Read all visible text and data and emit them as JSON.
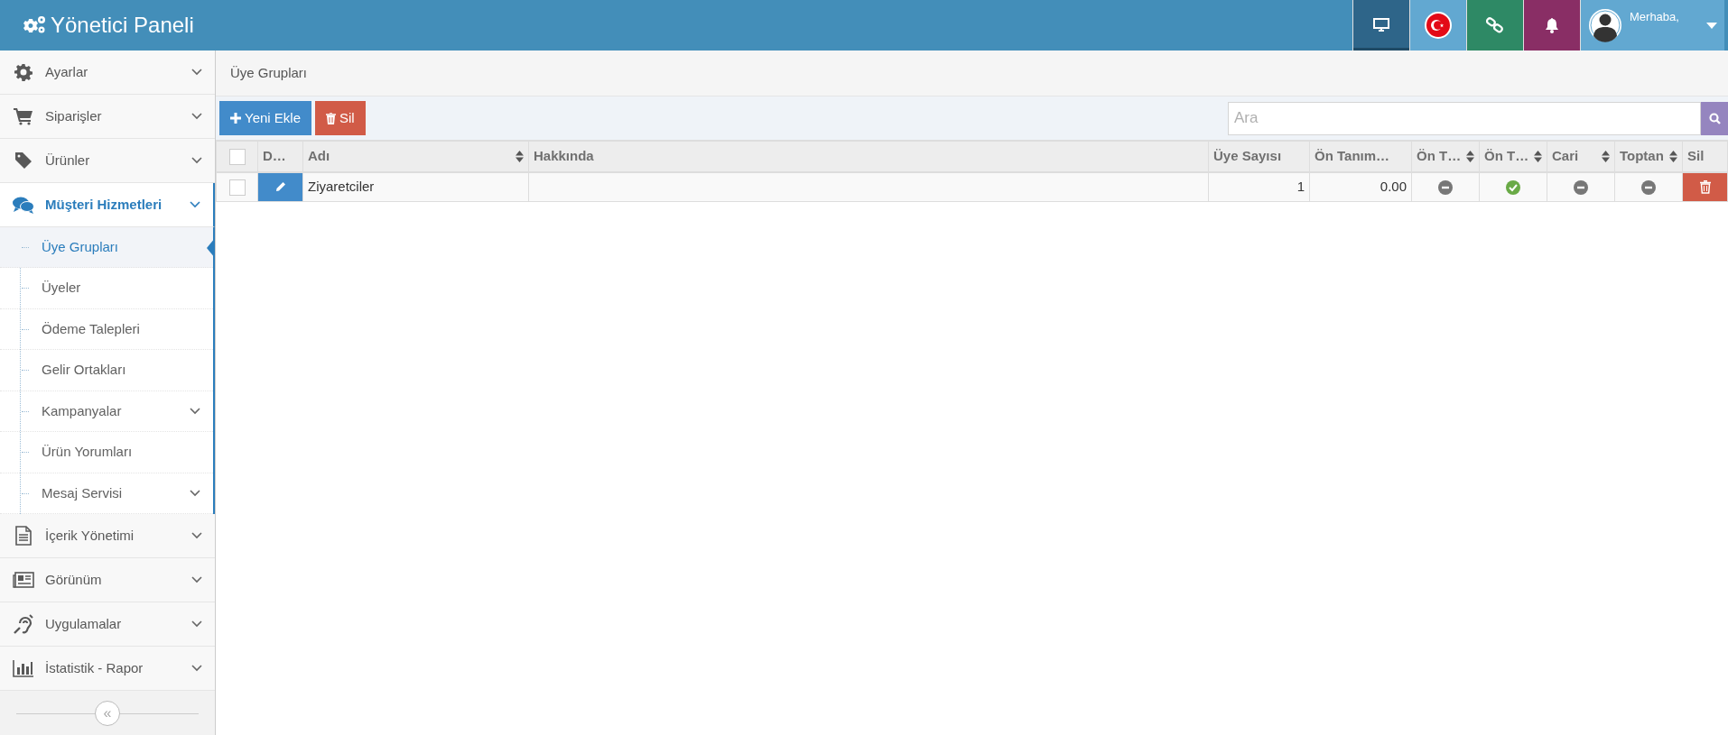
{
  "navbar": {
    "title": "Yönetici Paneli",
    "tiles": [
      {
        "kind": "monitor",
        "selected": true
      },
      {
        "kind": "flag",
        "selected": false
      },
      {
        "kind": "link",
        "selected": false
      },
      {
        "kind": "bell",
        "selected": false
      }
    ],
    "user": {
      "greeting": "Merhaba,"
    }
  },
  "sidebar": {
    "items": [
      {
        "label": "Ayarlar",
        "expanded": false,
        "selected": false
      },
      {
        "label": "Siparişler",
        "expanded": false,
        "selected": false
      },
      {
        "label": "Ürünler",
        "expanded": false,
        "selected": false
      },
      {
        "label": "Müşteri Hizmetleri",
        "expanded": true,
        "selected": true,
        "children": [
          {
            "label": "Üye Grupları",
            "selected": true,
            "submenu": false
          },
          {
            "label": "Üyeler",
            "selected": false,
            "submenu": false
          },
          {
            "label": "Ödeme Talepleri",
            "selected": false,
            "submenu": false
          },
          {
            "label": "Gelir Ortakları",
            "selected": false,
            "submenu": false
          },
          {
            "label": "Kampanyalar",
            "selected": false,
            "submenu": true
          },
          {
            "label": "Ürün Yorumları",
            "selected": false,
            "submenu": false
          },
          {
            "label": "Mesaj Servisi",
            "selected": false,
            "submenu": true
          }
        ]
      },
      {
        "label": "İçerik Yönetimi",
        "expanded": false,
        "selected": false
      },
      {
        "label": "Görünüm",
        "expanded": false,
        "selected": false
      },
      {
        "label": "Uygulamalar",
        "expanded": false,
        "selected": false
      },
      {
        "label": "İstatistik - Rapor",
        "expanded": false,
        "selected": false
      }
    ],
    "collapse_button": {
      "label": "«"
    }
  },
  "breadcrumb": "Üye Grupları",
  "toolbar": {
    "buttons": [
      {
        "kind": "add",
        "label": "Yeni Ekle"
      },
      {
        "kind": "delete",
        "label": "Sil"
      }
    ],
    "search": {
      "placeholder": "Ara"
    }
  },
  "table": {
    "columns": [
      {
        "kind": "checkbox",
        "checked": false
      },
      {
        "kind": "text",
        "label": "D…",
        "sortable": false
      },
      {
        "kind": "text",
        "label": "Adı",
        "sortable": true
      },
      {
        "kind": "text",
        "label": "Hakkında",
        "sortable": false
      },
      {
        "kind": "text",
        "label": "Üye Sayısı",
        "sortable": false
      },
      {
        "kind": "text",
        "label": "Ön Tanım…",
        "sortable": false
      },
      {
        "kind": "text",
        "label": "Ön T…",
        "sortable": true
      },
      {
        "kind": "text",
        "label": "Ön T…",
        "sortable": true
      },
      {
        "kind": "text",
        "label": "Cari",
        "sortable": true
      },
      {
        "kind": "text",
        "label": "Toptan",
        "sortable": true
      },
      {
        "kind": "text",
        "label": "Sil",
        "sortable": false
      }
    ],
    "rows": [
      {
        "selected": false,
        "cells": [
          {
            "kind": "checkbox",
            "checked": false
          },
          {
            "kind": "edit"
          },
          {
            "kind": "text",
            "text": "Ziyaretciler"
          },
          {
            "kind": "empty"
          },
          {
            "kind": "number",
            "text": "1"
          },
          {
            "kind": "number",
            "text": "0.00"
          },
          {
            "kind": "flag",
            "on": false
          },
          {
            "kind": "flag",
            "on": true
          },
          {
            "kind": "flag",
            "on": false
          },
          {
            "kind": "flag",
            "on": false
          },
          {
            "kind": "delete"
          }
        ]
      }
    ]
  }
}
